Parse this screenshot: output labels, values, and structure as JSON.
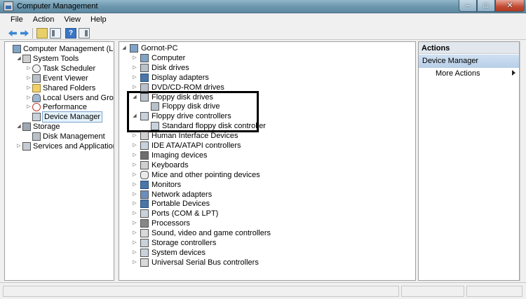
{
  "window": {
    "title": "Computer Management"
  },
  "menu": [
    "File",
    "Action",
    "View",
    "Help"
  ],
  "toolbar": {
    "help_label": "?"
  },
  "window_controls": {
    "minimize": "–",
    "maximize": "□",
    "close": "✕"
  },
  "left_tree": [
    {
      "label": "Computer Management (Local)",
      "icon": "computer-mgmt-icon",
      "depth": 0,
      "expander": ""
    },
    {
      "label": "System Tools",
      "icon": "tools-icon",
      "depth": 1,
      "expander": "◢"
    },
    {
      "label": "Task Scheduler",
      "icon": "clock-icon",
      "depth": 2,
      "expander": "▷"
    },
    {
      "label": "Event Viewer",
      "icon": "event-viewer-icon",
      "depth": 2,
      "expander": "▷"
    },
    {
      "label": "Shared Folders",
      "icon": "folder-icon",
      "depth": 2,
      "expander": "▷"
    },
    {
      "label": "Local Users and Groups",
      "icon": "users-icon",
      "depth": 2,
      "expander": "▷"
    },
    {
      "label": "Performance",
      "icon": "performance-icon",
      "depth": 2,
      "expander": "▷"
    },
    {
      "label": "Device Manager",
      "icon": "device-manager-icon",
      "depth": 2,
      "expander": "",
      "selected": true
    },
    {
      "label": "Storage",
      "icon": "storage-icon",
      "depth": 1,
      "expander": "◢"
    },
    {
      "label": "Disk Management",
      "icon": "disk-icon",
      "depth": 2,
      "expander": ""
    },
    {
      "label": "Services and Applications",
      "icon": "services-icon",
      "depth": 1,
      "expander": "▷"
    }
  ],
  "device_tree": {
    "root": {
      "label": "Gornot-PC",
      "icon": "computer-icon",
      "expander": "◢"
    },
    "items": [
      {
        "label": "Computer",
        "icon": "computer-icon",
        "depth": 1,
        "expander": "▷"
      },
      {
        "label": "Disk drives",
        "icon": "disk-icon",
        "depth": 1,
        "expander": "▷"
      },
      {
        "label": "Display adapters",
        "icon": "monitor-icon",
        "depth": 1,
        "expander": "▷"
      },
      {
        "label": "DVD/CD-ROM drives",
        "icon": "dvd-icon",
        "depth": 1,
        "expander": "▷"
      },
      {
        "label": "Floppy disk drives",
        "icon": "floppy-icon",
        "depth": 1,
        "expander": "◢"
      },
      {
        "label": "Floppy disk drive",
        "icon": "floppy-icon",
        "depth": 2,
        "expander": ""
      },
      {
        "label": "Floppy drive controllers",
        "icon": "controller-icon",
        "depth": 1,
        "expander": "◢"
      },
      {
        "label": "Standard floppy disk controller",
        "icon": "controller-icon",
        "depth": 2,
        "expander": ""
      },
      {
        "label": "Human Interface Devices",
        "icon": "hid-icon",
        "depth": 1,
        "expander": "▷"
      },
      {
        "label": "IDE ATA/ATAPI controllers",
        "icon": "ide-icon",
        "depth": 1,
        "expander": "▷"
      },
      {
        "label": "Imaging devices",
        "icon": "camera-icon",
        "depth": 1,
        "expander": "▷"
      },
      {
        "label": "Keyboards",
        "icon": "keyboard-icon",
        "depth": 1,
        "expander": "▷"
      },
      {
        "label": "Mice and other pointing devices",
        "icon": "mouse-icon",
        "depth": 1,
        "expander": "▷"
      },
      {
        "label": "Monitors",
        "icon": "monitor-icon",
        "depth": 1,
        "expander": "▷"
      },
      {
        "label": "Network adapters",
        "icon": "network-icon",
        "depth": 1,
        "expander": "▷"
      },
      {
        "label": "Portable Devices",
        "icon": "portable-icon",
        "depth": 1,
        "expander": "▷"
      },
      {
        "label": "Ports (COM & LPT)",
        "icon": "port-icon",
        "depth": 1,
        "expander": "▷"
      },
      {
        "label": "Processors",
        "icon": "processor-icon",
        "depth": 1,
        "expander": "▷"
      },
      {
        "label": "Sound, video and game controllers",
        "icon": "sound-icon",
        "depth": 1,
        "expander": "▷"
      },
      {
        "label": "Storage controllers",
        "icon": "storage-controller-icon",
        "depth": 1,
        "expander": "▷"
      },
      {
        "label": "System devices",
        "icon": "system-icon",
        "depth": 1,
        "expander": "▷"
      },
      {
        "label": "Universal Serial Bus controllers",
        "icon": "usb-icon",
        "depth": 1,
        "expander": "▷"
      }
    ]
  },
  "actions": {
    "header": "Actions",
    "section": "Device Manager",
    "items": [
      "More Actions"
    ]
  },
  "colors": {
    "selection": "#e5f3fb",
    "section_band": "#b8cfe8",
    "highlight_box": "#000000"
  }
}
